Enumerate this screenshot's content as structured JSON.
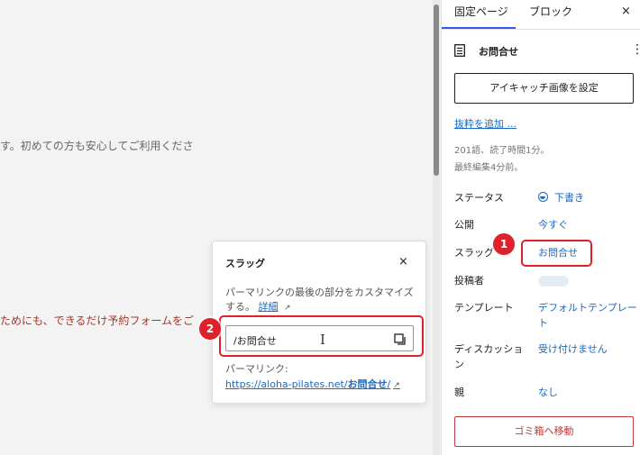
{
  "canvas": {
    "line1": "す。初めての方も安心してご利用くださ",
    "line2": "ためにも、できるだけ予約フォームをご"
  },
  "slug_popover": {
    "title": "スラッグ",
    "close_label": "×",
    "description": "パーマリンクの最後の部分をカスタマイズする。",
    "detail_link": "詳細",
    "detail_link_arrow": "↗",
    "slug_value": "/お問合せ",
    "permalink_label": "パーマリンク:",
    "permalink_base": "https://aloha-pilates.net/",
    "permalink_slug": "お問合せ",
    "permalink_trail": "/",
    "permalink_arrow": "↗"
  },
  "annotations": {
    "badge_1": "1",
    "badge_2": "2",
    "color": "#e0202a"
  },
  "sidebar": {
    "tabs": [
      {
        "label": "固定ページ",
        "active": true
      },
      {
        "label": "ブロック",
        "active": false
      }
    ],
    "close_label": "×",
    "doc_title": "お問合せ",
    "kebab_label": "⋮",
    "featured_image_button": "アイキャッチ画像を設定",
    "excerpt_link": "抜粋を追加 ...",
    "meta": [
      "201語、読了時間1分。",
      "最終編集4分前。"
    ],
    "properties": [
      {
        "label": "ステータス",
        "value": "下書き"
      },
      {
        "label": "公開",
        "value": "今すぐ"
      },
      {
        "label": "スラッグ",
        "value": "お問合せ"
      },
      {
        "label": "投稿者",
        "value": ""
      },
      {
        "label": "テンプレート",
        "value": "デフォルトテンプレート"
      },
      {
        "label": "ディスカッション",
        "value": "受け付けません"
      },
      {
        "label": "親",
        "value": "なし"
      }
    ],
    "trash_button": "ゴミ箱へ移動",
    "accent_color": "#3858e9",
    "link_color": "#1a69c4",
    "danger_color": "#c0393b"
  }
}
